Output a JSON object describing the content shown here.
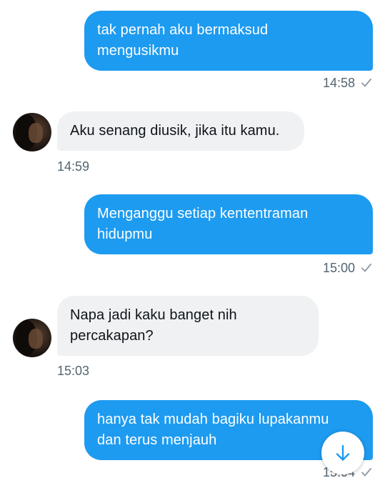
{
  "colors": {
    "outgoing_bubble": "#1d9bf0",
    "incoming_bubble": "#eff1f3",
    "timestamp": "#536471",
    "accent": "#1d9bf0"
  },
  "messages": [
    {
      "direction": "outgoing",
      "lines": [
        "tak pernah aku bermaksud",
        "mengusikmu"
      ],
      "time": "14:58",
      "status_icon": "check-icon"
    },
    {
      "direction": "incoming",
      "lines": [
        "Aku senang diusik, jika itu kamu."
      ],
      "time": "14:59"
    },
    {
      "direction": "outgoing",
      "lines": [
        "Menganggu setiap kententraman",
        "hidupmu"
      ],
      "time": "15:00",
      "status_icon": "check-icon"
    },
    {
      "direction": "incoming",
      "lines": [
        "Napa jadi kaku banget nih",
        "percakapan?"
      ],
      "time": "15:03"
    },
    {
      "direction": "outgoing",
      "lines": [
        "hanya tak mudah bagiku lupakanmu",
        "dan terus menjauh"
      ],
      "time": "15:04",
      "status_icon": "check-icon"
    }
  ],
  "scroll_button": {
    "icon": "arrow-down-icon"
  }
}
